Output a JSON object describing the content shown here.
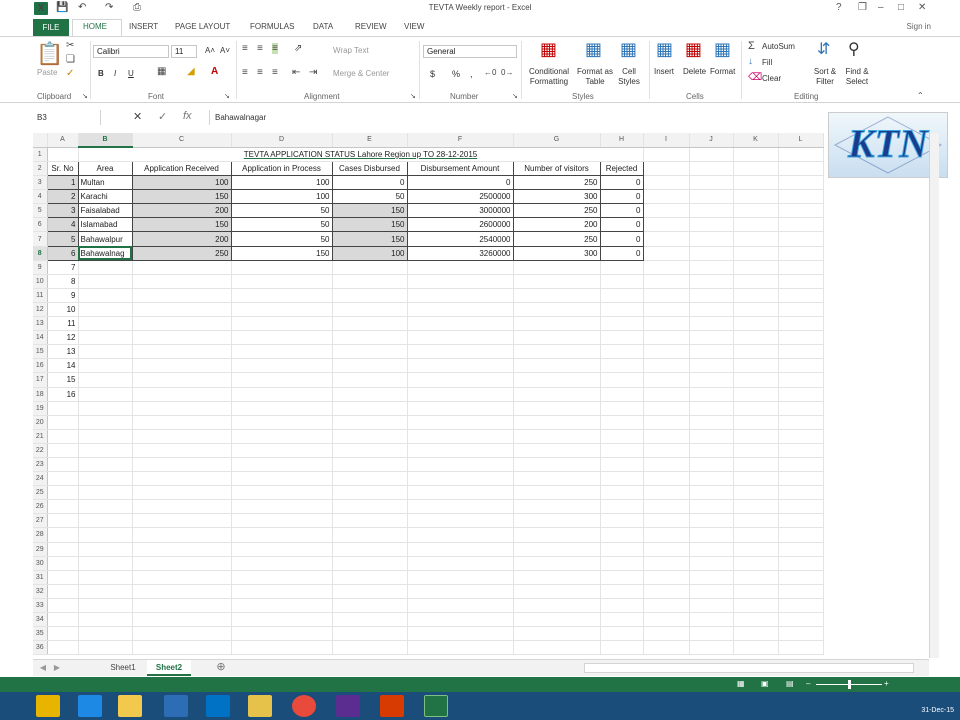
{
  "window": {
    "title": "TEVTA Weekly report - Excel",
    "help": "?",
    "restore": "❐",
    "minimize": "–",
    "maximize": "□",
    "close": "✕",
    "signin": "Sign in"
  },
  "ribbon_tabs": {
    "file": "FILE",
    "tabs": [
      "HOME",
      "INSERT",
      "PAGE LAYOUT",
      "FORMULAS",
      "DATA",
      "REVIEW",
      "VIEW"
    ]
  },
  "ribbon": {
    "clipboard": {
      "paste": "Paste",
      "label": "Clipboard"
    },
    "font": {
      "name": "Calibri",
      "size": "11",
      "bold": "B",
      "italic": "I",
      "underline": "U",
      "grow": "A˄",
      "shrink": "A˅",
      "label": "Font"
    },
    "alignment": {
      "wrap": "Wrap Text",
      "merge": "Merge & Center",
      "label": "Alignment"
    },
    "number": {
      "format": "General",
      "currency": "$",
      "percent": "%",
      "comma": ",",
      "label": "Number"
    },
    "styles": {
      "conditional": "Conditional Formatting",
      "format_table": "Format as Table",
      "cell_styles": "Cell Styles",
      "label": "Styles"
    },
    "cells": {
      "insert": "Insert",
      "delete": "Delete",
      "format": "Format",
      "label": "Cells"
    },
    "editing": {
      "autosum": "AutoSum",
      "fill": "Fill",
      "clear": "Clear",
      "sort": "Sort & Filter",
      "find": "Find & Select",
      "label": "Editing"
    }
  },
  "formula_bar": {
    "name_box": "B3",
    "fx": "fx",
    "value": "Bahawalnagar"
  },
  "columns": [
    "A",
    "B",
    "C",
    "D",
    "E",
    "F",
    "G",
    "H",
    "I",
    "J",
    "K",
    "L"
  ],
  "sheet": {
    "title_row": "TEVTA APPLICATION STATUS Lahore Region up TO 28-12-2015",
    "headers": [
      "Sr. No",
      "Area",
      "Application Received",
      "Application in Process",
      "Cases Disbursed",
      "Disbursement Amount",
      "Number of visitors",
      "Rejected"
    ],
    "rows": [
      [
        "1",
        "Multan",
        "100",
        "100",
        "0",
        "0",
        "250",
        "0"
      ],
      [
        "2",
        "Karachi",
        "150",
        "100",
        "50",
        "2500000",
        "300",
        "0"
      ],
      [
        "3",
        "Faisalabad",
        "200",
        "50",
        "150",
        "3000000",
        "250",
        "0"
      ],
      [
        "4",
        "Islamabad",
        "150",
        "50",
        "150",
        "2600000",
        "200",
        "0"
      ],
      [
        "5",
        "Bahawalpur",
        "200",
        "50",
        "150",
        "2540000",
        "250",
        "0"
      ],
      [
        "6",
        "Bahawalnag",
        "250",
        "150",
        "100",
        "3260000",
        "300",
        "0"
      ]
    ],
    "extra_sr": [
      "7",
      "8",
      "9",
      "10",
      "11",
      "12",
      "13",
      "14",
      "15",
      "16"
    ],
    "row_numbers": [
      "1",
      "2",
      "3",
      "4",
      "5",
      "6",
      "7",
      "8",
      "9",
      "10",
      "11",
      "12",
      "13",
      "14",
      "15",
      "16",
      "17",
      "18",
      "19",
      "20",
      "21",
      "22",
      "23",
      "24",
      "25",
      "26",
      "27",
      "28",
      "29",
      "30",
      "31",
      "32",
      "33",
      "34",
      "35",
      "36"
    ]
  },
  "logo": {
    "text": "KTN",
    "colors": {
      "primary": "#1a3c8c",
      "glow": "#3da5e0"
    }
  },
  "sheet_tabs": [
    "Sheet1",
    "Sheet2"
  ],
  "active_sheet": "Sheet2",
  "status_bar": {
    "zoom": "–",
    "zoom_plus": "+"
  },
  "taskbar": {
    "clock": "31-Dec-15"
  },
  "colors": {
    "excel_green": "#217346",
    "taskbar": "#1a4d7a"
  }
}
